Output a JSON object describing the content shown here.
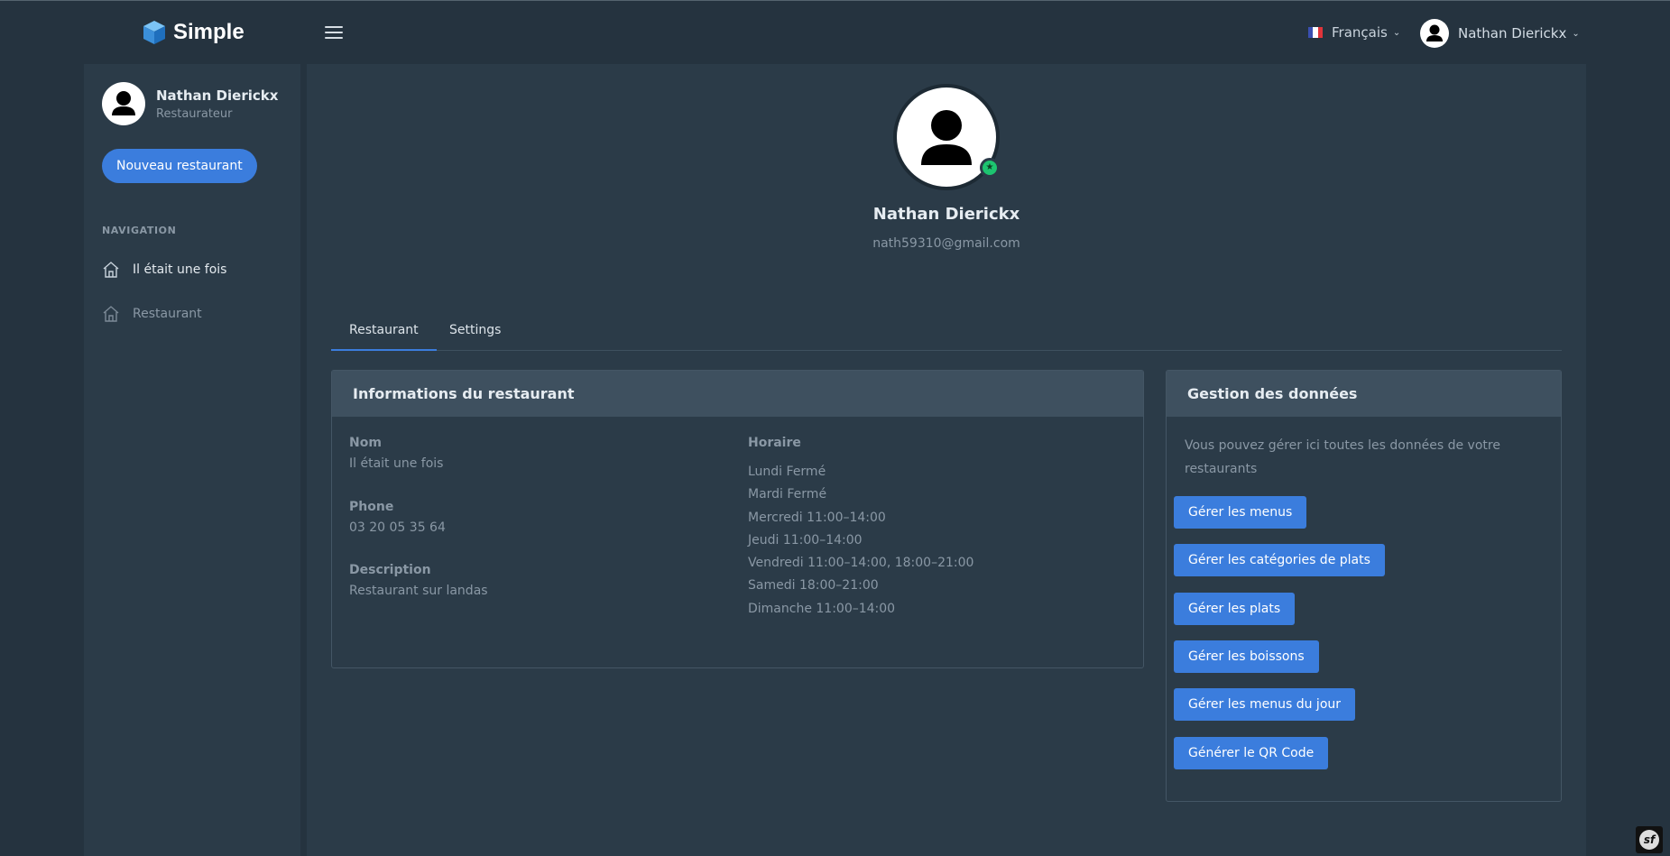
{
  "app": {
    "brand": "Simple"
  },
  "topbar": {
    "language": "Français",
    "user_name": "Nathan Dierickx"
  },
  "sidebar": {
    "user_name": "Nathan Dierickx",
    "user_role": "Restaurateur",
    "new_button": "Nouveau restaurant",
    "nav_heading": "NAVIGATION",
    "items": [
      {
        "label": "Il était une fois",
        "icon": "home-icon"
      },
      {
        "label": "Restaurant",
        "icon": "home-icon"
      }
    ]
  },
  "profile": {
    "name": "Nathan Dierickx",
    "email": "nath59310@gmail.com",
    "status": "online"
  },
  "tabs": [
    {
      "label": "Restaurant",
      "active": true
    },
    {
      "label": "Settings",
      "active": false
    }
  ],
  "info_card": {
    "title": "Informations du restaurant",
    "fields": [
      {
        "label": "Nom",
        "value": "Il était une fois"
      },
      {
        "label": "Phone",
        "value": "03 20 05 35 64"
      },
      {
        "label": "Description",
        "value": "Restaurant sur landas"
      }
    ],
    "schedule_label": "Horaire",
    "schedule": [
      "Lundi Fermé",
      "Mardi Fermé",
      "Mercredi 11:00–14:00",
      "Jeudi 11:00–14:00",
      "Vendredi 11:00–14:00, 18:00–21:00",
      "Samedi 18:00–21:00",
      "Dimanche 11:00–14:00"
    ]
  },
  "mgmt_card": {
    "title": "Gestion des données",
    "description": "Vous pouvez gérer ici toutes les données de votre restaurants",
    "buttons": [
      "Gérer les menus",
      "Gérer les catégories de plats",
      "Gérer les plats",
      "Gérer les boissons",
      "Gérer les menus du jour",
      "Générer le QR Code"
    ]
  },
  "colors": {
    "accent": "#3b7ddd",
    "background": "#25333f",
    "panel": "#2b3b48",
    "online": "#1dc470"
  }
}
